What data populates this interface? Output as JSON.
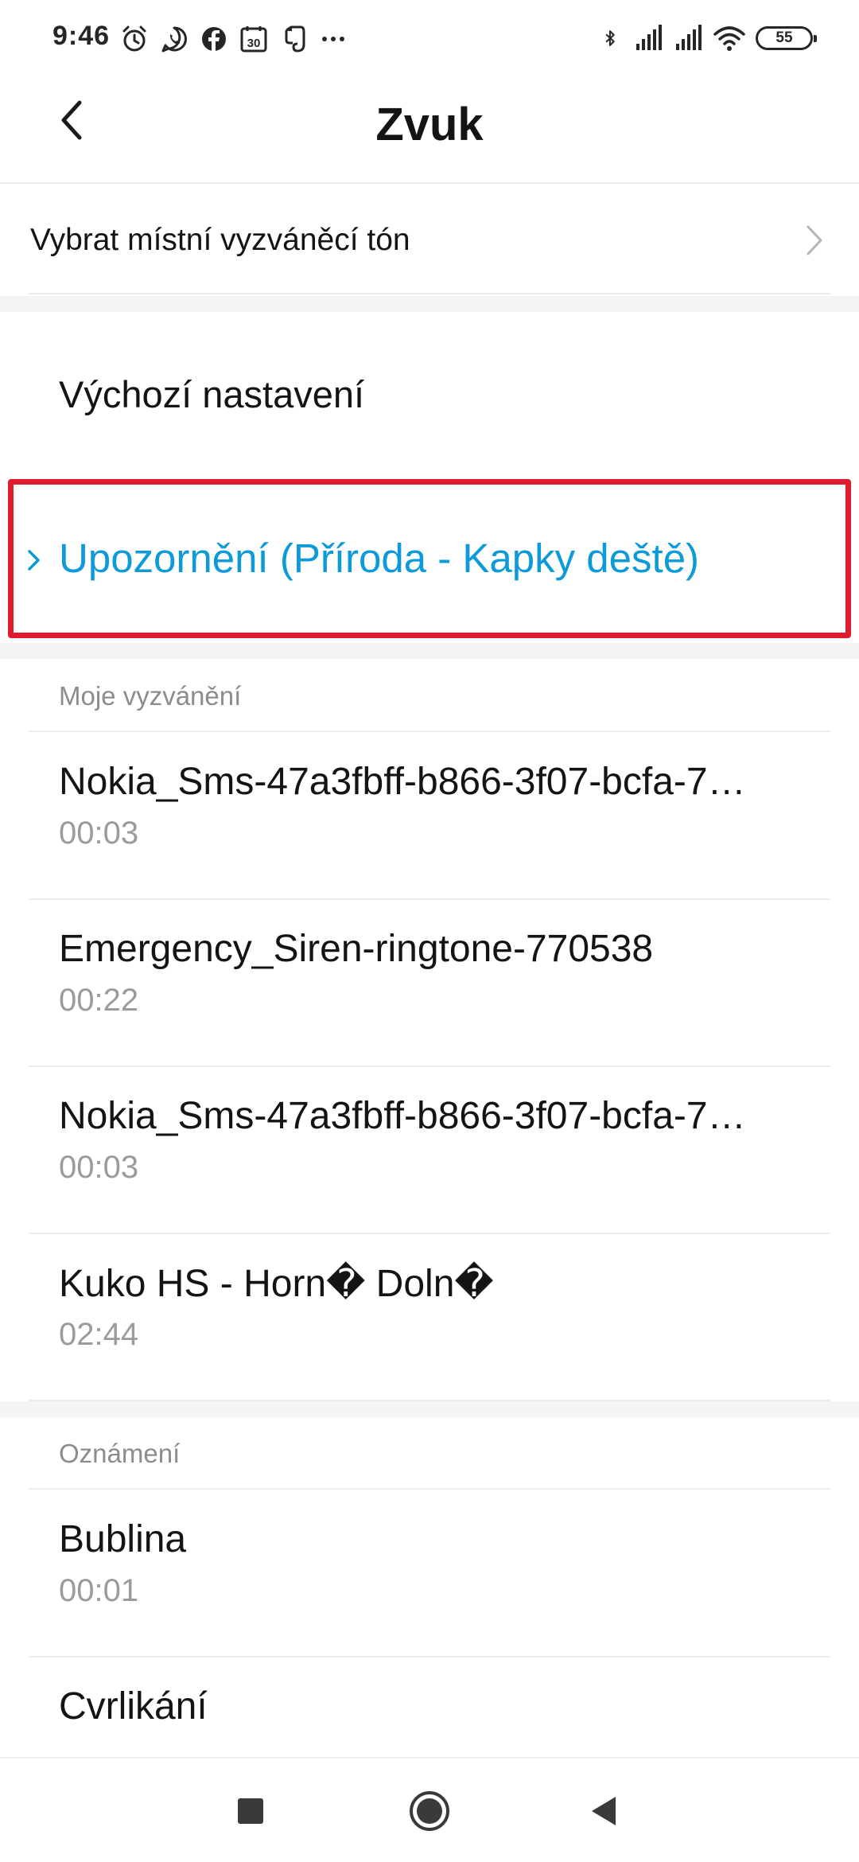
{
  "status_bar": {
    "time": "9:46",
    "battery": "55",
    "left_icons": [
      "alarm-icon",
      "whatsapp-icon",
      "facebook-icon",
      "calendar-icon",
      "evernote-icon",
      "more-dots-icon"
    ],
    "calendar_day": "30",
    "right_icons": [
      "bluetooth-icon",
      "signal-icon",
      "signal-icon",
      "wifi-icon",
      "battery-icon"
    ]
  },
  "header": {
    "title": "Zvuk",
    "back_icon": "chevron-left-icon"
  },
  "local_ringtone": {
    "label": "Vybrat místní vyzváněcí tón",
    "icon": "chevron-right-icon"
  },
  "default_settings": {
    "title": "Výchozí nastavení",
    "notification_label": "Upozornění (Příroda - Kapky deště)",
    "accent_color": "#0d9ad9",
    "highlight_color": "#e01b2e"
  },
  "my_ringtones": {
    "header": "Moje vyzvánění",
    "items": [
      {
        "name": "Nokia_Sms-47a3fbff-b866-3f07-bcfa-7…",
        "duration": "00:03"
      },
      {
        "name": "Emergency_Siren-ringtone-770538",
        "duration": "00:22"
      },
      {
        "name": "Nokia_Sms-47a3fbff-b866-3f07-bcfa-7…",
        "duration": "00:03"
      },
      {
        "name": "Kuko HS - Horn� Doln�",
        "duration": "02:44"
      }
    ]
  },
  "notifications": {
    "header": "Oznámení",
    "items": [
      {
        "name": "Bublina",
        "duration": "00:01"
      },
      {
        "name": "Cvrlikání"
      }
    ]
  },
  "nav_bar": {
    "buttons": [
      "recents-square-icon",
      "home-circle-icon",
      "back-triangle-icon"
    ]
  }
}
